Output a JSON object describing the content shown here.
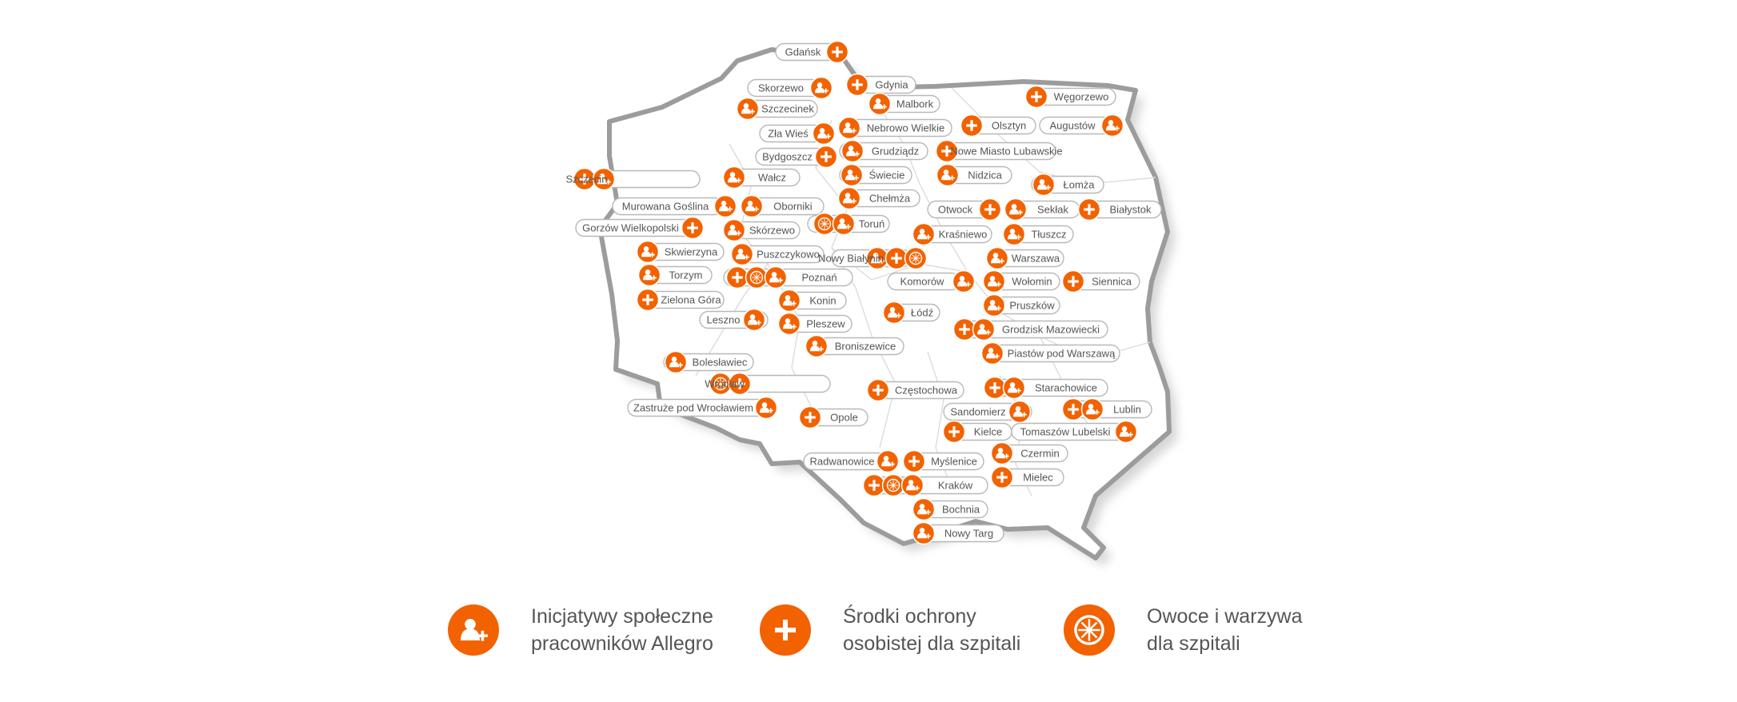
{
  "colors": {
    "accent": "#f26200",
    "outline": "#9c9c9c",
    "pill_border": "#b8b8b8",
    "text": "#555555"
  },
  "legend": [
    {
      "icon": "person-plus-icon",
      "line1": "Inicjatywy społeczne",
      "line2": "pracowników Allegro"
    },
    {
      "icon": "plus-icon",
      "line1": "Środki ochrony",
      "line2": "osobistej dla szpitali"
    },
    {
      "icon": "fruit-slice-icon",
      "line1": "Owoce i warzywa",
      "line2": "dla szpitali"
    }
  ],
  "locations": [
    {
      "name": "Gdańsk",
      "icons": [
        "plus"
      ]
    },
    {
      "name": "Gdynia",
      "icons": [
        "plus"
      ]
    },
    {
      "name": "Skorzewo",
      "icons": [
        "person"
      ]
    },
    {
      "name": "Malbork",
      "icons": [
        "person"
      ]
    },
    {
      "name": "Węgorzewo",
      "icons": [
        "plus"
      ]
    },
    {
      "name": "Szczecinek",
      "icons": [
        "person"
      ]
    },
    {
      "name": "Nebrowo Wielkie",
      "icons": [
        "person"
      ]
    },
    {
      "name": "Olsztyn",
      "icons": [
        "plus"
      ]
    },
    {
      "name": "Augustów",
      "icons": [
        "person"
      ]
    },
    {
      "name": "Zła Wieś",
      "icons": [
        "person"
      ]
    },
    {
      "name": "Grudziądz",
      "icons": [
        "person"
      ]
    },
    {
      "name": "Nowe Miasto Lubawskie",
      "icons": [
        "plus"
      ]
    },
    {
      "name": "Bydgoszcz",
      "icons": [
        "plus"
      ]
    },
    {
      "name": "Szczecin",
      "icons": [
        "plus",
        "person"
      ]
    },
    {
      "name": "Wałcz",
      "icons": [
        "person"
      ]
    },
    {
      "name": "Świecie",
      "icons": [
        "person"
      ]
    },
    {
      "name": "Nidzica",
      "icons": [
        "person"
      ]
    },
    {
      "name": "Łomża",
      "icons": [
        "person"
      ]
    },
    {
      "name": "Chełmża",
      "icons": [
        "person"
      ]
    },
    {
      "name": "Murowana Goślina",
      "icons": [
        "person"
      ]
    },
    {
      "name": "Oborniki",
      "icons": [
        "person"
      ]
    },
    {
      "name": "Otwock",
      "icons": [
        "plus"
      ]
    },
    {
      "name": "Sekłak",
      "icons": [
        "person"
      ]
    },
    {
      "name": "Białystok",
      "icons": [
        "plus"
      ]
    },
    {
      "name": "Gorzów Wielkopolski",
      "icons": [
        "plus"
      ]
    },
    {
      "name": "Skórzewo",
      "icons": [
        "person"
      ]
    },
    {
      "name": "Toruń",
      "icons": [
        "fruit",
        "person"
      ]
    },
    {
      "name": "Kraśniewo",
      "icons": [
        "person"
      ]
    },
    {
      "name": "Tłuszcz",
      "icons": [
        "person"
      ]
    },
    {
      "name": "Skwierzyna",
      "icons": [
        "person"
      ]
    },
    {
      "name": "Puszczykowo",
      "icons": [
        "person"
      ]
    },
    {
      "name": "Nowy Białynin",
      "icons": [
        "person",
        "plus",
        "fruit"
      ]
    },
    {
      "name": "Warszawa",
      "icons": [
        "person"
      ]
    },
    {
      "name": "Torzym",
      "icons": [
        "person"
      ]
    },
    {
      "name": "Poznań",
      "icons": [
        "plus",
        "fruit",
        "person"
      ]
    },
    {
      "name": "Komorów",
      "icons": [
        "person"
      ]
    },
    {
      "name": "Wołomin",
      "icons": [
        "person"
      ]
    },
    {
      "name": "Siennica",
      "icons": [
        "plus"
      ]
    },
    {
      "name": "Zielona Góra",
      "icons": [
        "plus"
      ]
    },
    {
      "name": "Konin",
      "icons": [
        "person"
      ]
    },
    {
      "name": "Pruszków",
      "icons": [
        "person"
      ]
    },
    {
      "name": "Leszno",
      "icons": [
        "person"
      ]
    },
    {
      "name": "Łódź",
      "icons": [
        "person"
      ]
    },
    {
      "name": "Pleszew",
      "icons": [
        "person"
      ]
    },
    {
      "name": "Grodzisk Mazowiecki",
      "icons": [
        "plus",
        "person"
      ]
    },
    {
      "name": "Broniszewice",
      "icons": [
        "person"
      ]
    },
    {
      "name": "Piastów pod Warszawą",
      "icons": [
        "person"
      ]
    },
    {
      "name": "Bolesławiec",
      "icons": [
        "person"
      ]
    },
    {
      "name": "Wrocław",
      "icons": [
        "fruit",
        "plus"
      ]
    },
    {
      "name": "Częstochowa",
      "icons": [
        "plus"
      ]
    },
    {
      "name": "Starachowice",
      "icons": [
        "plus",
        "person"
      ]
    },
    {
      "name": "Zastruże pod Wrocławiem",
      "icons": [
        "person"
      ]
    },
    {
      "name": "Sandomierz",
      "icons": [
        "person"
      ]
    },
    {
      "name": "Lublin",
      "icons": [
        "plus",
        "person"
      ]
    },
    {
      "name": "Opole",
      "icons": [
        "plus"
      ]
    },
    {
      "name": "Kielce",
      "icons": [
        "plus"
      ]
    },
    {
      "name": "Tomaszów Lubelski",
      "icons": [
        "person"
      ]
    },
    {
      "name": "Czermin",
      "icons": [
        "person"
      ]
    },
    {
      "name": "Radwanowice",
      "icons": [
        "person"
      ]
    },
    {
      "name": "Myślenice",
      "icons": [
        "plus"
      ]
    },
    {
      "name": "Mielec",
      "icons": [
        "plus"
      ]
    },
    {
      "name": "Kraków",
      "icons": [
        "plus",
        "fruit",
        "person"
      ]
    },
    {
      "name": "Bochnia",
      "icons": [
        "person"
      ]
    },
    {
      "name": "Nowy Targ",
      "icons": [
        "person"
      ]
    }
  ]
}
